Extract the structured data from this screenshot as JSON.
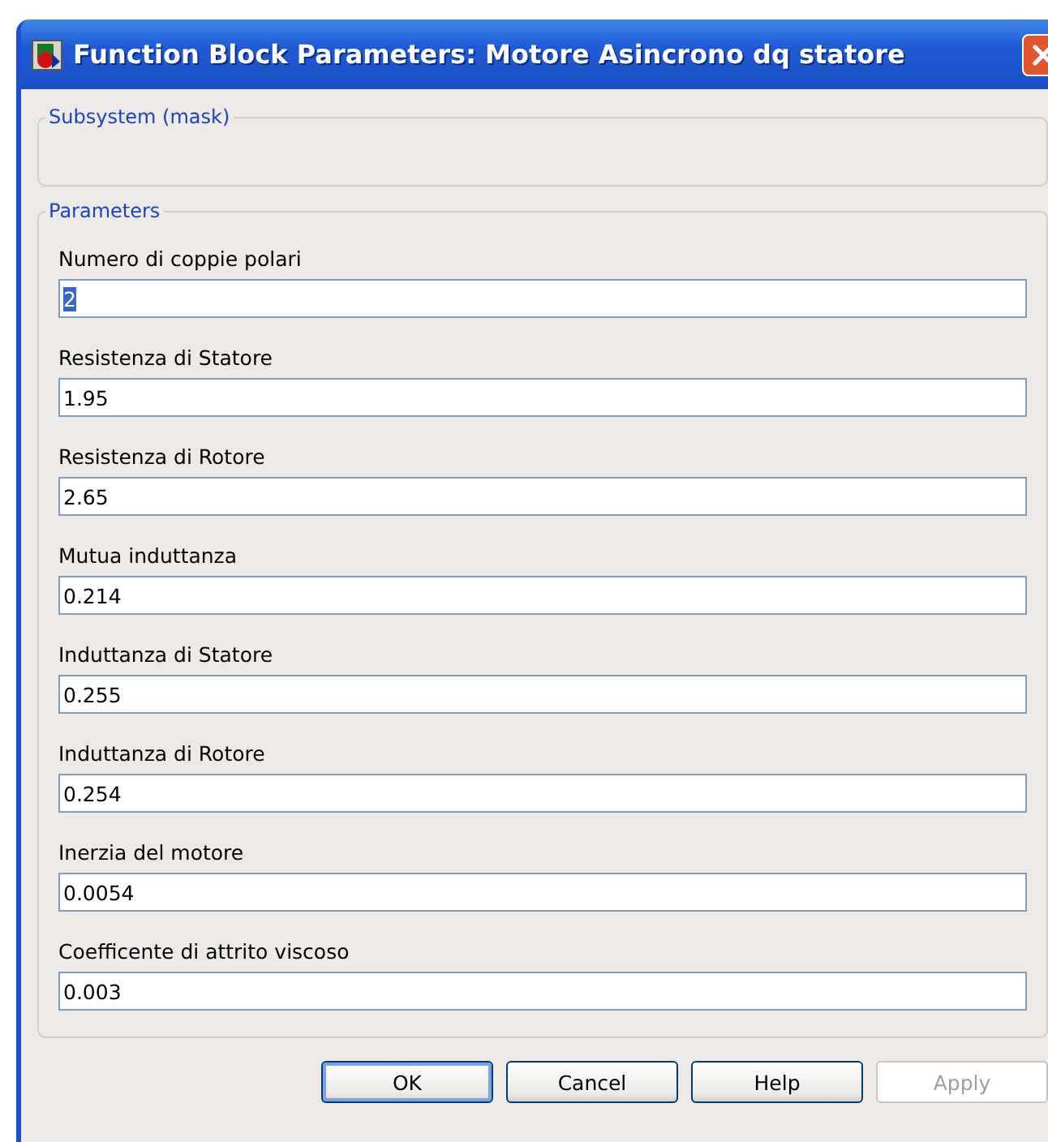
{
  "window": {
    "title": "Function Block Parameters: Motore Asincrono dq statore"
  },
  "subsystem_group": {
    "legend": "Subsystem (mask)"
  },
  "parameters_group": {
    "legend": "Parameters",
    "fields": [
      {
        "label": "Numero di coppie polari",
        "value": "2",
        "selected": true
      },
      {
        "label": "Resistenza di Statore",
        "value": "1.95",
        "selected": false
      },
      {
        "label": "Resistenza di Rotore",
        "value": "2.65",
        "selected": false
      },
      {
        "label": "Mutua induttanza",
        "value": "0.214",
        "selected": false
      },
      {
        "label": "Induttanza di Statore",
        "value": "0.255",
        "selected": false
      },
      {
        "label": "Induttanza di Rotore",
        "value": "0.254",
        "selected": false
      },
      {
        "label": "Inerzia del motore",
        "value": "0.0054",
        "selected": false
      },
      {
        "label": "Coefficente di attrito viscoso",
        "value": "0.003",
        "selected": false
      }
    ]
  },
  "buttons": [
    {
      "label": "OK",
      "disabled": false,
      "selected": true
    },
    {
      "label": "Cancel",
      "disabled": false,
      "selected": false
    },
    {
      "label": "Help",
      "disabled": false,
      "selected": false
    },
    {
      "label": "Apply",
      "disabled": true,
      "selected": false
    }
  ]
}
